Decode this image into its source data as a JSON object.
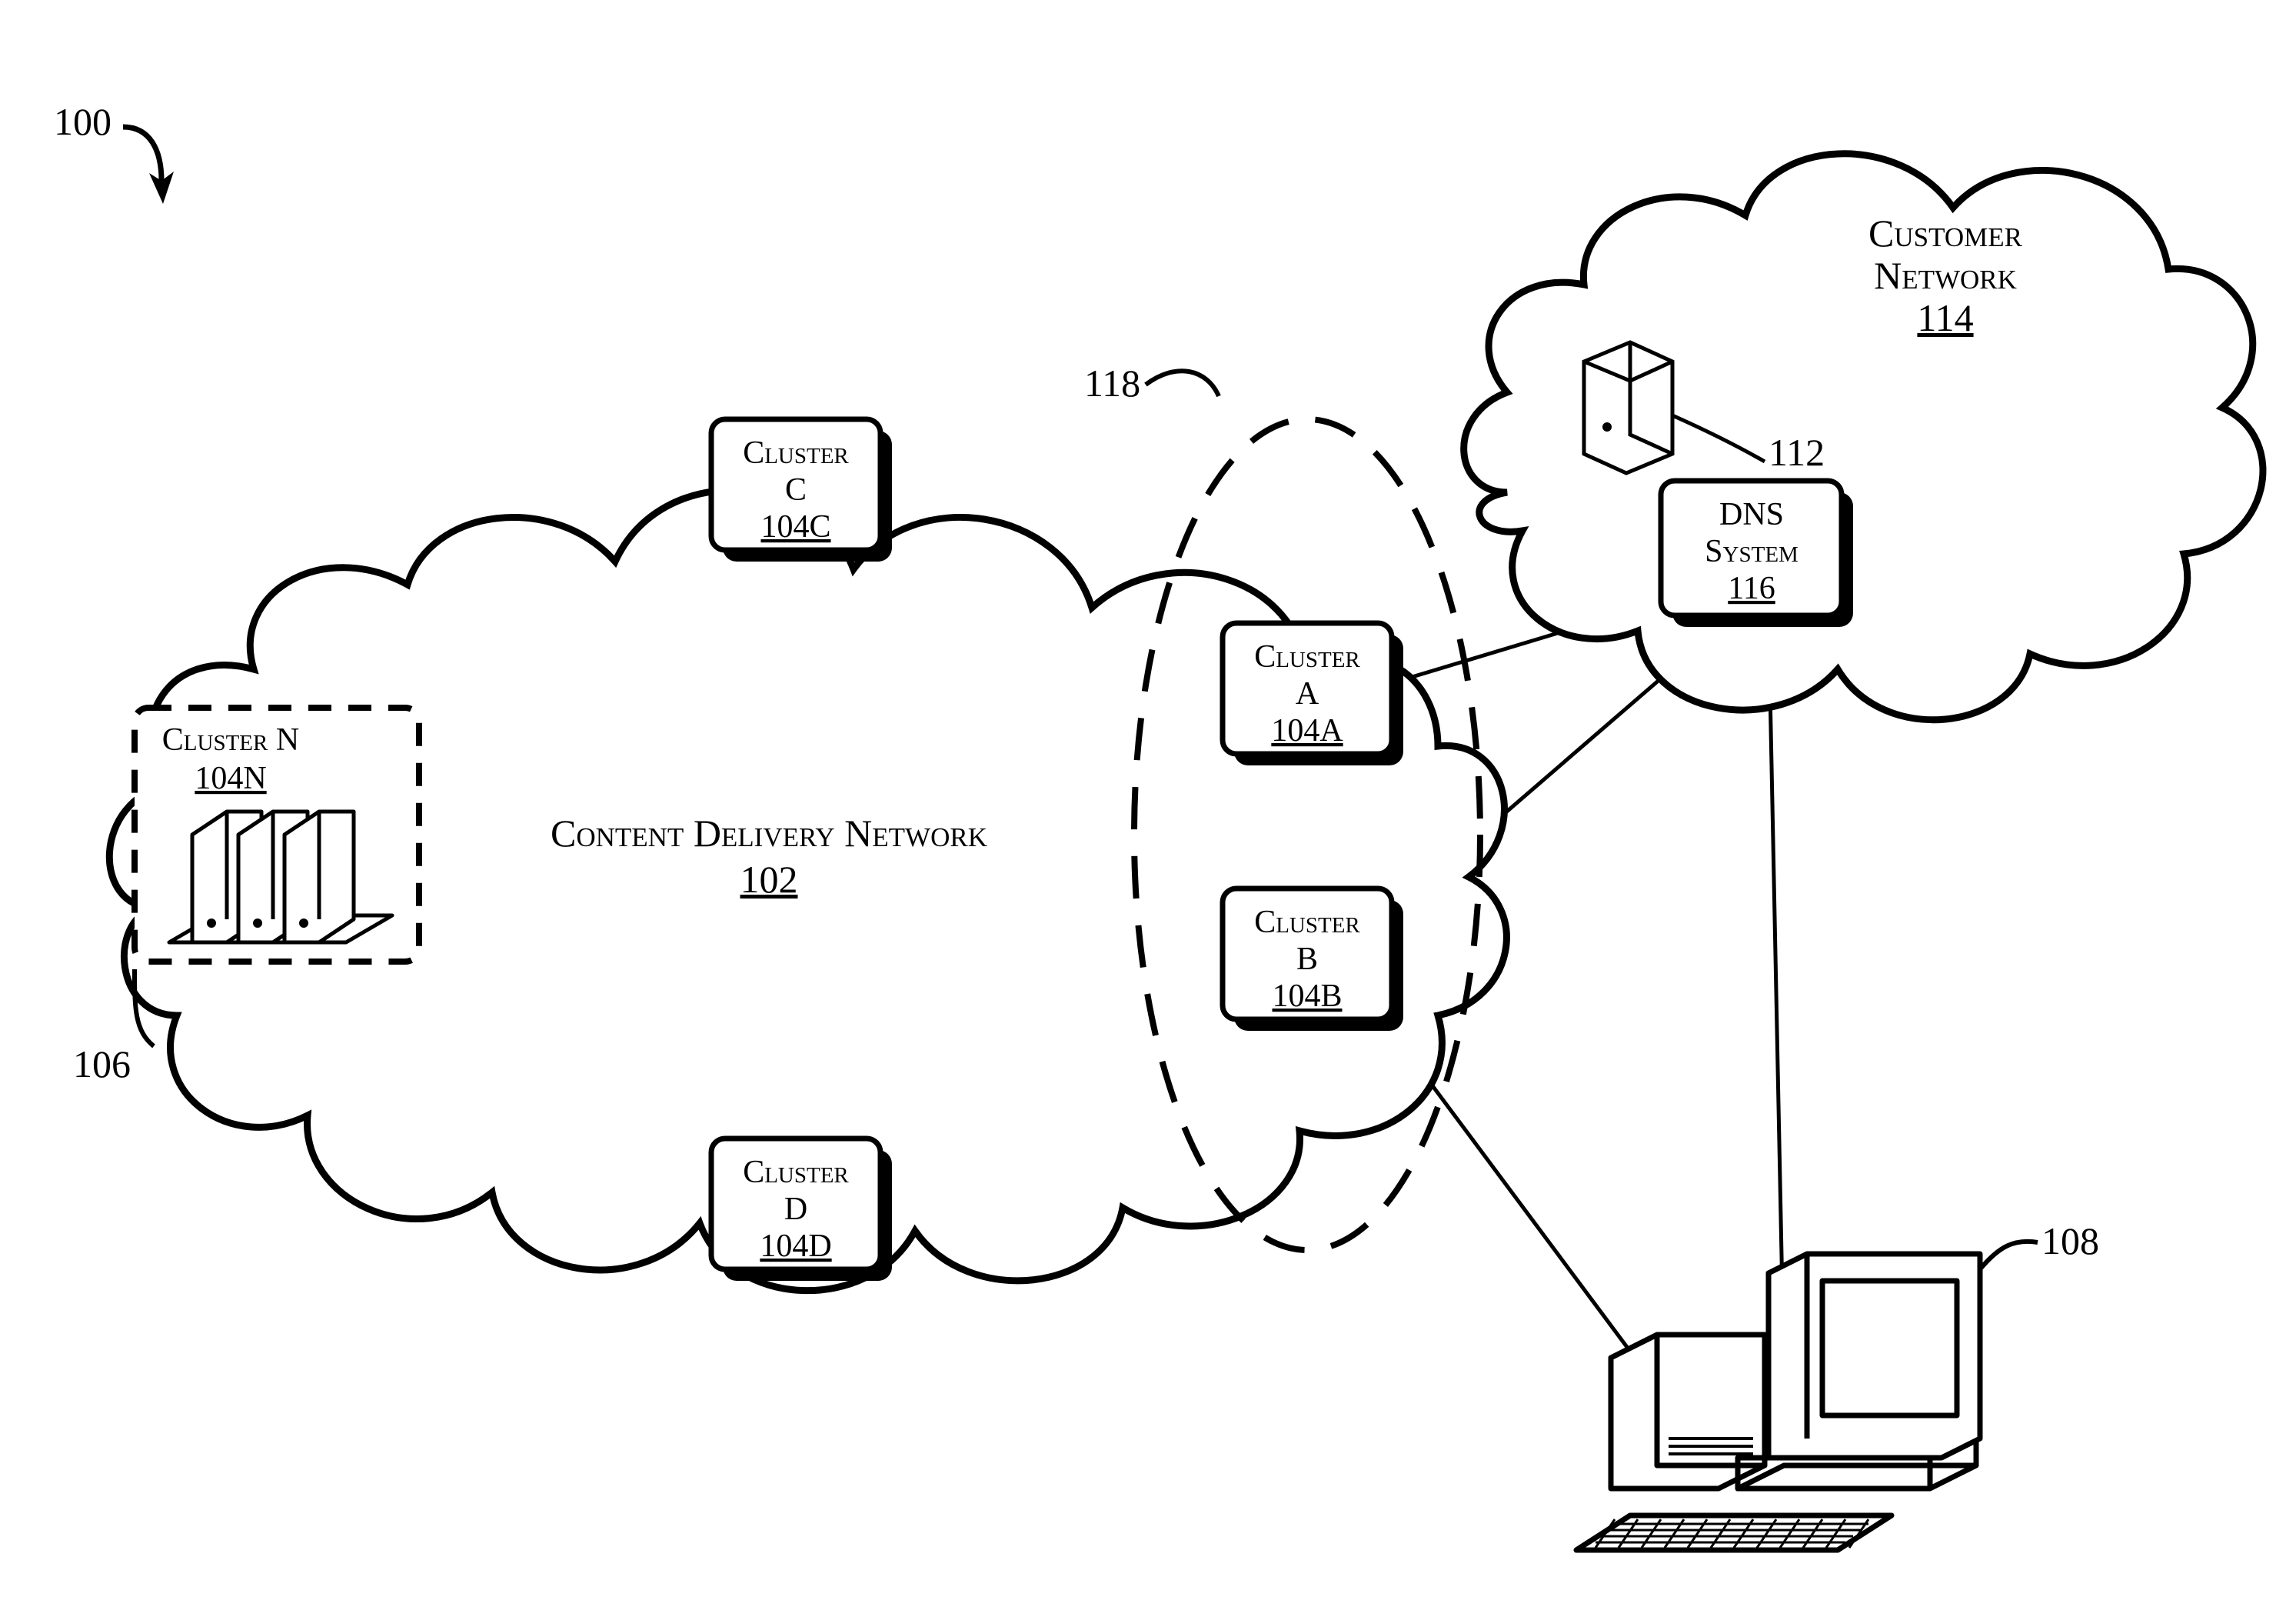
{
  "figure_ref": "100",
  "cdn": {
    "title": "Content Delivery Network",
    "ref": "102"
  },
  "clusters": {
    "a": {
      "name": "Cluster",
      "letter": "A",
      "ref": "104A"
    },
    "b": {
      "name": "Cluster",
      "letter": "B",
      "ref": "104B"
    },
    "c": {
      "name": "Cluster",
      "letter": "C",
      "ref": "104C"
    },
    "d": {
      "name": "Cluster",
      "letter": "D",
      "ref": "104D"
    },
    "n": {
      "name": "Cluster N",
      "ref": "104N"
    }
  },
  "customer_net": {
    "title_l1": "Customer",
    "title_l2": "Network",
    "ref": "114"
  },
  "dns": {
    "title_l1": "DNS",
    "title_l2": "System",
    "ref": "116"
  },
  "callouts": {
    "cluster_n_servers": "106",
    "client_pc": "108",
    "customer_server": "112",
    "dashed_ellipse": "118"
  }
}
